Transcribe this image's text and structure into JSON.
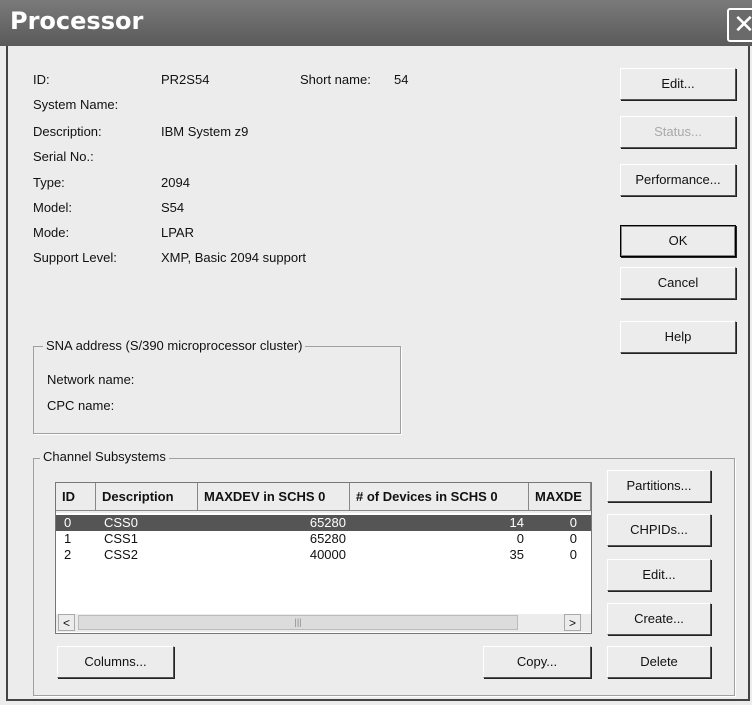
{
  "window": {
    "title": "Processor",
    "close_glyph": "✕"
  },
  "fields": [
    {
      "label": "ID:",
      "value": "PR2S54"
    },
    {
      "label": "System Name:",
      "value": ""
    },
    {
      "label": "Description:",
      "value": "IBM System z9"
    },
    {
      "label": "Serial No.:",
      "value": ""
    },
    {
      "label": "Type:",
      "value": "2094"
    },
    {
      "label": "Model:",
      "value": "S54"
    },
    {
      "label": "Mode:",
      "value": "LPAR"
    },
    {
      "label": "Support Level:",
      "value": "XMP, Basic 2094 support"
    }
  ],
  "short_name": {
    "label": "Short name:",
    "value": "54"
  },
  "buttons": {
    "edit": "Edit...",
    "status": "Status...",
    "performance": "Performance...",
    "ok": "OK",
    "cancel": "Cancel",
    "help": "Help"
  },
  "sna": {
    "title": "SNA address (S/390 microprocessor cluster)",
    "network_label": "Network name:",
    "cpc_label": "CPC name:"
  },
  "css": {
    "title": "Channel Subsystems",
    "columns": [
      "ID",
      "Description",
      "MAXDEV in SCHS 0",
      "# of Devices in SCHS 0",
      "MAXDE"
    ],
    "rows": [
      [
        "0",
        "CSS0",
        "65280",
        "14",
        "0"
      ],
      [
        "1",
        "CSS1",
        "65280",
        "0",
        "0"
      ],
      [
        "2",
        "CSS2",
        "40000",
        "35",
        "0"
      ]
    ],
    "selected_row": 0,
    "buttons": {
      "partitions": "Partitions...",
      "chpids": "CHPIDs...",
      "edit": "Edit...",
      "create": "Create...",
      "delete": "Delete",
      "columns": "Columns...",
      "copy": "Copy..."
    },
    "scroll_left": "<",
    "scroll_right": ">",
    "scroll_grip": "|||"
  },
  "colors": {
    "titlebar": "#666666",
    "selected_row": "#555555",
    "dialog_bg": "#ececec"
  }
}
